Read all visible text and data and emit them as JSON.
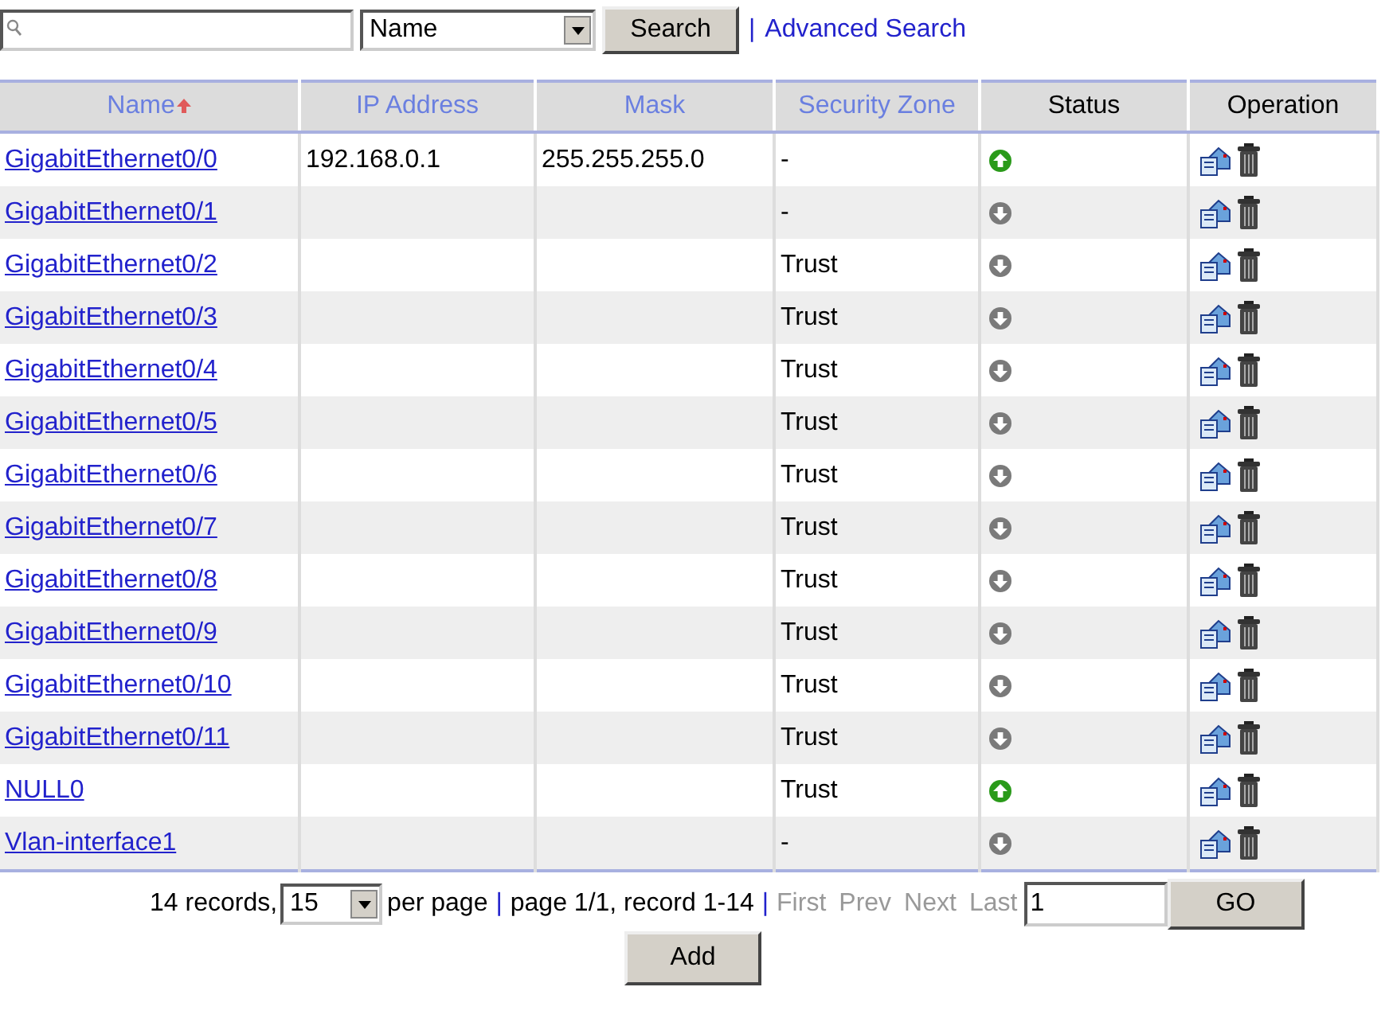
{
  "search": {
    "field": "Name",
    "button": "Search",
    "separator": "|",
    "advanced": "Advanced Search"
  },
  "table": {
    "columns": [
      {
        "label": "Name",
        "sorted_ascending": true,
        "link": true
      },
      {
        "label": "IP Address",
        "link": true
      },
      {
        "label": "Mask",
        "link": true
      },
      {
        "label": "Security Zone",
        "link": true
      },
      {
        "label": "Status",
        "link": false
      },
      {
        "label": "Operation",
        "link": false
      }
    ],
    "rows": [
      {
        "name": "GigabitEthernet0/0",
        "ip": "192.168.0.1",
        "mask": "255.255.255.0",
        "zone": "-",
        "up": true
      },
      {
        "name": "GigabitEthernet0/1",
        "zone": "-",
        "up": false
      },
      {
        "name": "GigabitEthernet0/2",
        "zone": "Trust",
        "up": false
      },
      {
        "name": "GigabitEthernet0/3",
        "zone": "Trust",
        "up": false
      },
      {
        "name": "GigabitEthernet0/4",
        "zone": "Trust",
        "up": false
      },
      {
        "name": "GigabitEthernet0/5",
        "zone": "Trust",
        "up": false
      },
      {
        "name": "GigabitEthernet0/6",
        "zone": "Trust",
        "up": false
      },
      {
        "name": "GigabitEthernet0/7",
        "zone": "Trust",
        "up": false
      },
      {
        "name": "GigabitEthernet0/8",
        "zone": "Trust",
        "up": false
      },
      {
        "name": "GigabitEthernet0/9",
        "zone": "Trust",
        "up": false
      },
      {
        "name": "GigabitEthernet0/10",
        "zone": "Trust",
        "up": false
      },
      {
        "name": "GigabitEthernet0/11",
        "zone": "Trust",
        "up": false
      },
      {
        "name": "NULL0",
        "zone": "Trust",
        "up": true
      },
      {
        "name": "Vlan-interface1",
        "zone": "-",
        "up": false
      }
    ]
  },
  "pager": {
    "records": "14 records,",
    "per_page_value": "15",
    "per_page": "per page",
    "sep1": "|",
    "info": "page 1/1, record 1-14",
    "sep2": "|",
    "links": [
      {
        "label": "First",
        "disabled": true
      },
      {
        "label": "Prev",
        "disabled": true
      },
      {
        "label": "Next",
        "disabled": true
      },
      {
        "label": "Last",
        "disabled": true
      }
    ],
    "page_value": "1",
    "go": "GO"
  },
  "add_button": "Add"
}
